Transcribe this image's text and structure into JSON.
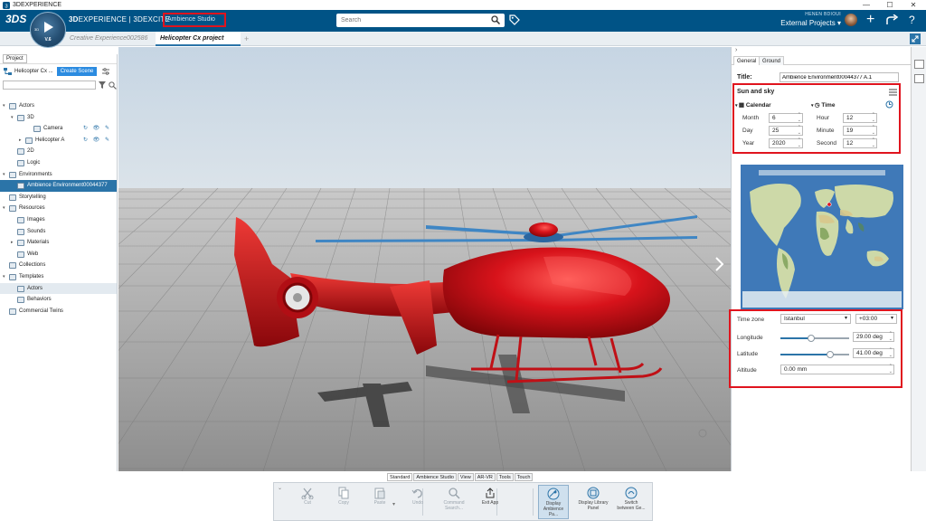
{
  "window": {
    "title": "3DEXPERIENCE",
    "controls": [
      "—",
      "☐",
      "✕"
    ]
  },
  "topbar": {
    "ds_logo": "3DS",
    "compass_version": "V.6",
    "compass_ring": "3D",
    "brand_prefix": "3D",
    "brand_main": "EXPERIENCE | 3DEXCITE",
    "app_name": "Ambience Studio",
    "search_placeholder": "Search",
    "user_name": "HENEN BDIOUI",
    "workspace": "External Projects ▾",
    "plus_icon": "+",
    "share_icon": "⇪",
    "help_icon": "?"
  },
  "tabs": [
    {
      "label": "Creative Experience002586",
      "active": false
    },
    {
      "label": "Helicopter  Cx project",
      "active": true
    }
  ],
  "left_panel": {
    "tab_label": "Project",
    "project_name": "Helicopter  Cx ...",
    "create_scene_label": "Create Scene",
    "tree": [
      {
        "label": "Actors",
        "indent": 0,
        "twisty": "▾"
      },
      {
        "label": "3D",
        "indent": 1,
        "twisty": "▾"
      },
      {
        "label": "Camera",
        "indent": 3,
        "twisty": "",
        "actions": "↻ 👁 ✎"
      },
      {
        "label": "Helicopter A",
        "indent": 2,
        "twisty": "▸",
        "actions": "↻ 👁 ✎"
      },
      {
        "label": "2D",
        "indent": 1,
        "twisty": ""
      },
      {
        "label": "Logic",
        "indent": 1,
        "twisty": ""
      },
      {
        "label": "Environments",
        "indent": 0,
        "twisty": "▾"
      },
      {
        "label": "Ambience Environment00044377",
        "indent": 1,
        "twisty": "",
        "selected": true
      },
      {
        "label": "Storytelling",
        "indent": 0,
        "twisty": ""
      },
      {
        "label": "Resources",
        "indent": 0,
        "twisty": "▾"
      },
      {
        "label": "Images",
        "indent": 1,
        "twisty": ""
      },
      {
        "label": "Sounds",
        "indent": 1,
        "twisty": ""
      },
      {
        "label": "Materials",
        "indent": 1,
        "twisty": "▸"
      },
      {
        "label": "Web",
        "indent": 1,
        "twisty": ""
      },
      {
        "label": "Collections",
        "indent": 0,
        "twisty": ""
      },
      {
        "label": "Templates",
        "indent": 0,
        "twisty": "▾"
      },
      {
        "label": "Actors",
        "indent": 1,
        "twisty": "",
        "highlight": true
      },
      {
        "label": "Behaviors",
        "indent": 1,
        "twisty": ""
      },
      {
        "label": "Commercial Twins",
        "indent": 0,
        "twisty": ""
      }
    ]
  },
  "right_panel": {
    "tab_general": "General",
    "tab_ground": "Ground",
    "title_label": "Title:",
    "title_value": "Ambience Environment00044377 A.1",
    "sun_sky_title": "Sun and sky",
    "calendar_label": "Calendar",
    "time_label": "Time",
    "month_label": "Month",
    "month_value": "6",
    "day_label": "Day",
    "day_value": "25",
    "year_label": "Year",
    "year_value": "2020",
    "hour_label": "Hour",
    "hour_value": "12",
    "minute_label": "Minute",
    "minute_value": "19",
    "second_label": "Second",
    "second_value": "12",
    "timezone_label": "Time zone",
    "timezone_value": "Istanbul",
    "utc_value": "+03:00",
    "longitude_label": "Longitude",
    "longitude_value": "29.00 deg",
    "longitude_level": 0.45,
    "latitude_label": "Latitude",
    "latitude_value": "41.00 deg",
    "latitude_level": 0.73,
    "altitude_label": "Altitude",
    "altitude_value": "0.00 mm"
  },
  "bottom": {
    "tabs": [
      "Standard",
      "Ambience Studio",
      "View",
      "AR-VR",
      "Tools",
      "Touch"
    ],
    "tools": [
      {
        "label": "Cut",
        "disabled": true
      },
      {
        "label": "Copy",
        "disabled": true
      },
      {
        "label": "Paste",
        "disabled": true
      },
      {
        "label": "Undo",
        "disabled": true
      },
      {
        "label": "Command Search...",
        "disabled": true
      },
      {
        "label": "Exit App",
        "disabled": false
      },
      {
        "label": "Display Ambience Pa...",
        "disabled": false,
        "active": true
      },
      {
        "label": "Display Library Panel",
        "disabled": false
      },
      {
        "label": "Switch between Ge...",
        "disabled": false
      }
    ]
  },
  "colors": {
    "topbar": "#005386",
    "accent": "#2b74a8",
    "highlight_box": "#e0141e",
    "helicopter": "#d4131b"
  }
}
